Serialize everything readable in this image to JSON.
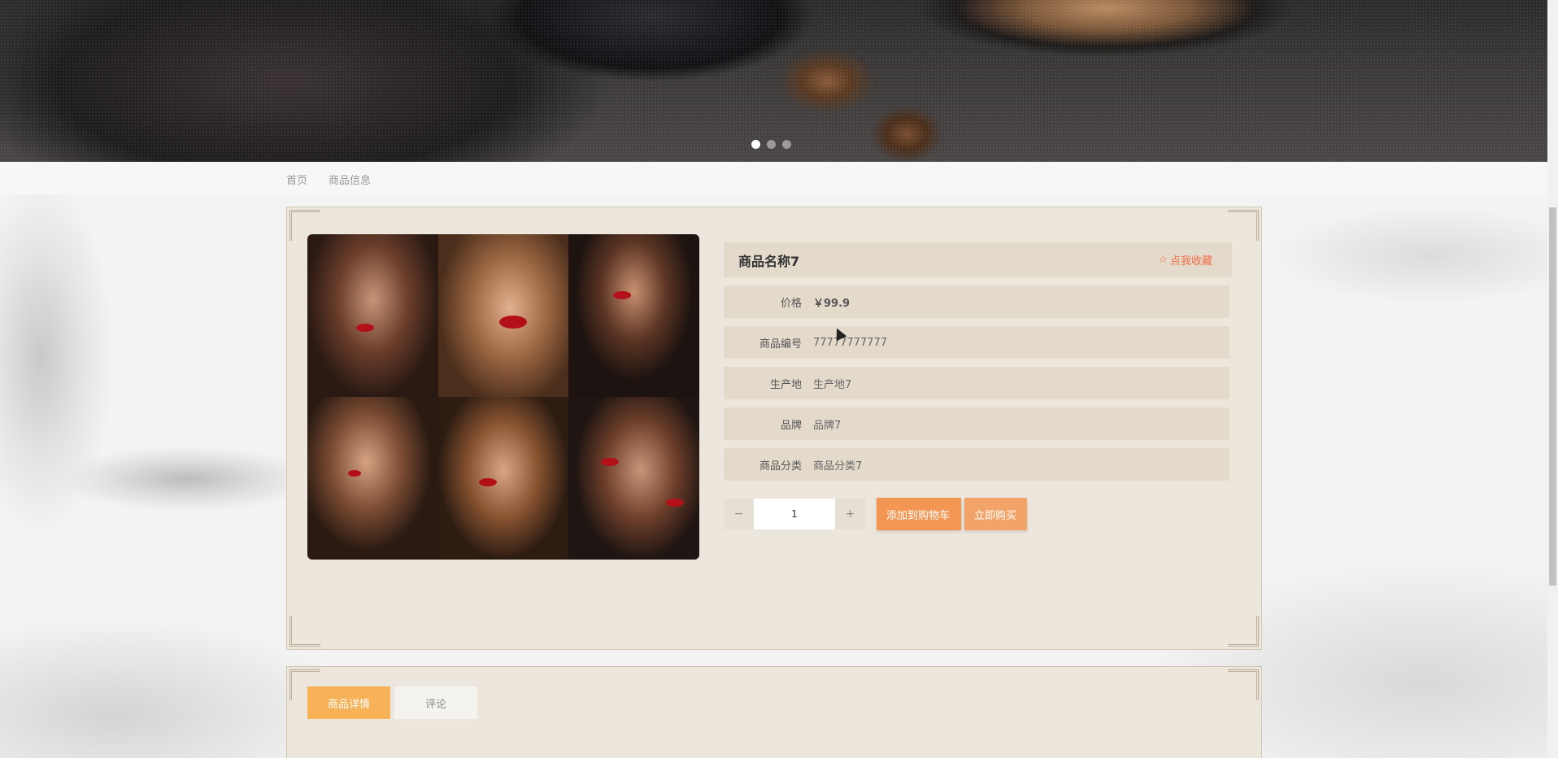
{
  "carousel": {
    "dots": [
      true,
      false,
      false
    ]
  },
  "breadcrumb": {
    "home": "首页",
    "current": "商品信息"
  },
  "product": {
    "name": "商品名称7",
    "favorite_label": "点我收藏",
    "rows": [
      {
        "label": "价格",
        "value": "￥99.9"
      },
      {
        "label": "商品编号",
        "value": "77777777777"
      },
      {
        "label": "生产地",
        "value": "生产地7"
      },
      {
        "label": "品牌",
        "value": "品牌7"
      },
      {
        "label": "商品分类",
        "value": "商品分类7"
      }
    ],
    "quantity": "1",
    "minus": "−",
    "plus": "+",
    "add_to_cart": "添加到购物车",
    "buy_now": "立即购买"
  },
  "tabs": {
    "detail": "商品详情",
    "comments": "评论"
  },
  "colors": {
    "accent": "#f5a05a",
    "tab_active": "#f7b258",
    "panel_bg": "#ece6dc",
    "favorite": "#f26c45"
  }
}
